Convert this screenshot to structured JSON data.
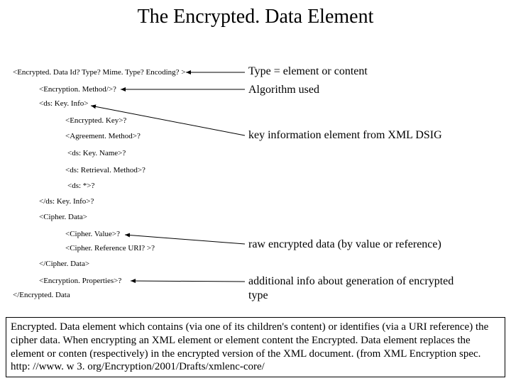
{
  "title": "The Encrypted. Data Element",
  "xml": {
    "l0": "<Encrypted. Data Id? Type? Mime. Type? Encoding? >",
    "l1": "<Encryption. Method/>?",
    "l2": "<ds: Key. Info>",
    "l3": "<Encrypted. Key>?",
    "l4": "<Agreement. Method>?",
    "l5": "<ds: Key. Name>?",
    "l6": "<ds: Retrieval. Method>?",
    "l7": "<ds: *>?",
    "l8": "</ds: Key. Info>?",
    "l9": "<Cipher. Data>",
    "l10": "<Cipher. Value>?",
    "l11": "<Cipher. Reference URI? >?",
    "l12": "</Cipher. Data>",
    "l13": "<Encryption. Properties>?",
    "l14": "</Encrypted. Data"
  },
  "anno": {
    "a0": "Type = element or content",
    "a1": "Algorithm used",
    "a2": "key information element from XML DSIG",
    "a3": "raw encrypted data (by value or reference)",
    "a4": "additional info about generation of encrypted",
    "a4b": "type"
  },
  "footer": "Encrypted. Data element which contains (via one of its children's content) or identifies (via a URI reference) the cipher data. When encrypting an XML element or element content the Encrypted. Data element replaces the element or conten (respectively) in the encrypted version of the XML document. (from XML Encryption spec. http: //www. w 3. org/Encryption/2001/Drafts/xmlenc-core/"
}
